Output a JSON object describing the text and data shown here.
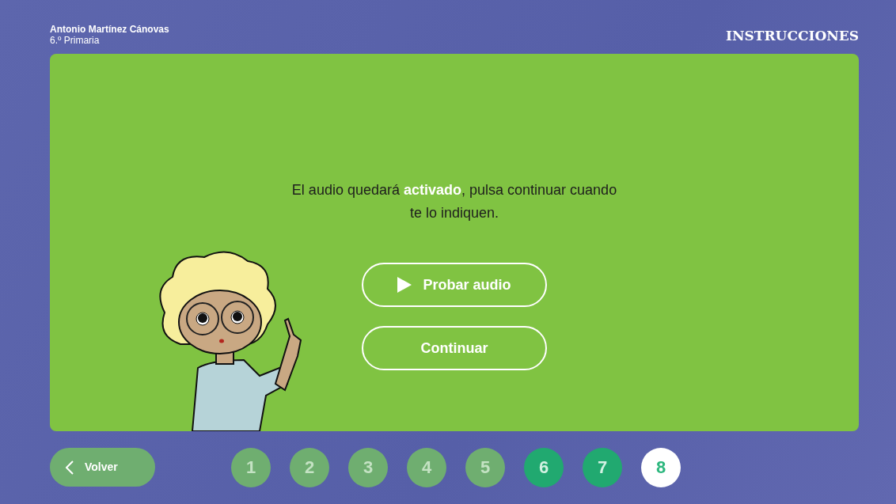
{
  "student": {
    "name": "Antonio Martínez Cánovas",
    "grade": "6.º Primaria"
  },
  "section_title": "INSTRUCCIONES",
  "message": "El audio quedará **activado**, pulsa continuar cuando te lo indiquen.",
  "buttons": [
    {
      "label": "Probar audio",
      "kind": "play"
    },
    {
      "label": "Continuar",
      "kind": "plain"
    }
  ],
  "back_button": {
    "label": "Volver"
  },
  "steps": [
    {
      "label": "1",
      "disabled": true,
      "selected": false
    },
    {
      "label": "2",
      "disabled": true,
      "selected": false
    },
    {
      "label": "3",
      "disabled": true,
      "selected": false
    },
    {
      "label": "4",
      "disabled": true,
      "selected": false
    },
    {
      "label": "5",
      "disabled": true,
      "selected": false
    },
    {
      "label": "6",
      "disabled": false,
      "selected": false
    },
    {
      "label": "7",
      "disabled": false,
      "selected": false
    },
    {
      "label": "8",
      "disabled": false,
      "selected": true
    }
  ]
}
